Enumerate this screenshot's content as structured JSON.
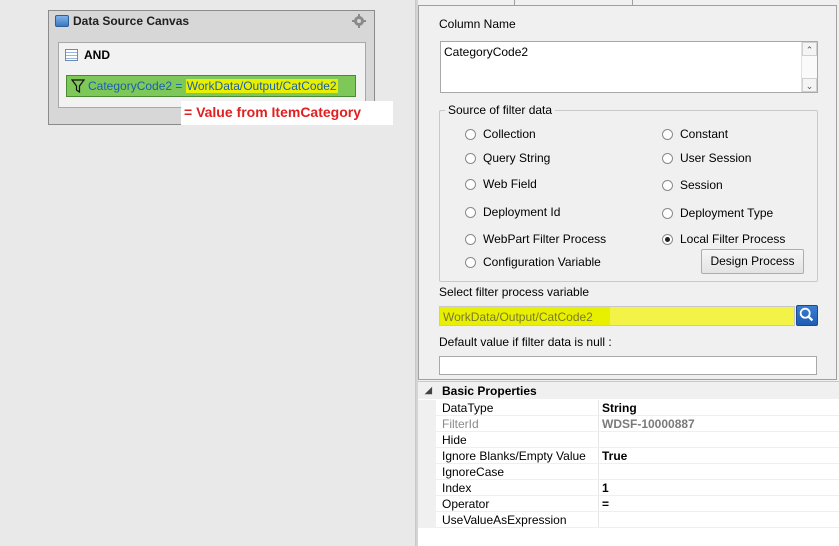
{
  "canvas": {
    "title": "Data Source Canvas",
    "group_label": "AND",
    "filter_field": "CategoryCode2",
    "filter_op": " = ",
    "filter_value": "WorkData/Output/CatCode2",
    "annotation": "= Value from ItemCategory",
    "highlight_color": "#e8f000",
    "filter_color": "#7ec85a",
    "annotation_color": "#e02020"
  },
  "panel": {
    "column_name_label": "Column Name",
    "column_name_value": "CategoryCode2",
    "source_group_label": "Source of filter data",
    "radios": [
      {
        "label": "Collection",
        "checked": false
      },
      {
        "label": "Constant",
        "checked": false
      },
      {
        "label": "Query String",
        "checked": false
      },
      {
        "label": "User Session",
        "checked": false
      },
      {
        "label": "Web Field",
        "checked": false
      },
      {
        "label": "Session",
        "checked": false
      },
      {
        "label": "Deployment Id",
        "checked": false
      },
      {
        "label": "Deployment Type",
        "checked": false
      },
      {
        "label": "WebPart Filter Process",
        "checked": false
      },
      {
        "label": "Local Filter Process",
        "checked": true
      },
      {
        "label": "Configuration Variable",
        "checked": false
      }
    ],
    "design_process_button": "Design Process",
    "select_var_label": "Select filter process variable",
    "select_var_value": "WorkData/Output/CatCode2",
    "default_value_label": "Default value if filter data is null :",
    "default_value": ""
  },
  "properties": {
    "section": "Basic Properties",
    "rows": [
      {
        "key": "DataType",
        "value": "String"
      },
      {
        "key": "FilterId",
        "value": "WDSF-10000887"
      },
      {
        "key": "Hide",
        "value": ""
      },
      {
        "key": "Ignore Blanks/Empty Value",
        "value": "True"
      },
      {
        "key": "IgnoreCase",
        "value": ""
      },
      {
        "key": "Index",
        "value": "1"
      },
      {
        "key": "Operator",
        "value": "="
      },
      {
        "key": "UseValueAsExpression",
        "value": ""
      }
    ]
  },
  "icons": [
    "database-icon",
    "gear-icon",
    "and-group-icon",
    "funnel-icon",
    "search-icon",
    "collapse-triangle-icon",
    "scroll-up-icon",
    "scroll-down-icon"
  ]
}
